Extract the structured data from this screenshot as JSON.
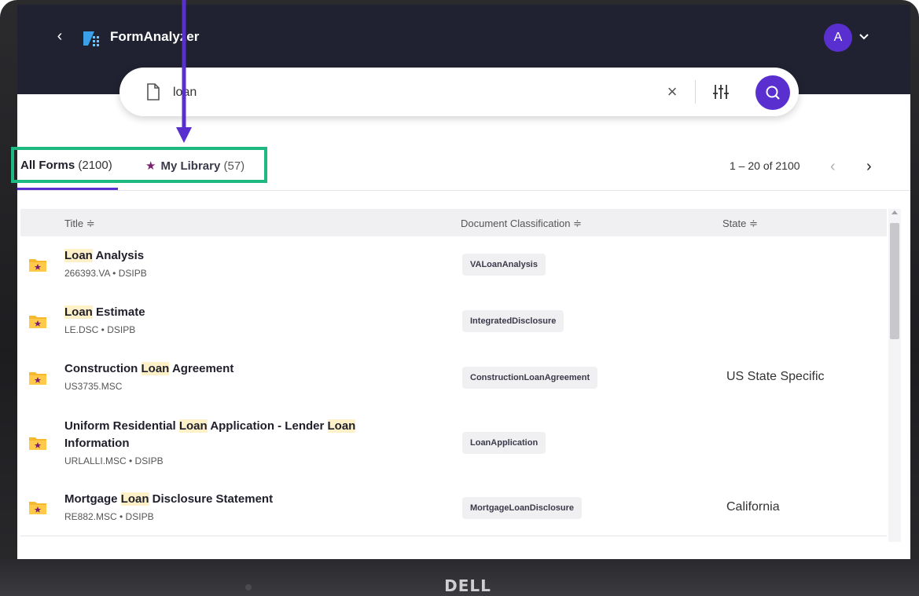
{
  "app": {
    "name": "FormAnalyzer",
    "avatar_initial": "A"
  },
  "search": {
    "value": "loan",
    "placeholder": ""
  },
  "tabs": {
    "all_forms_label": "All Forms",
    "all_forms_count": "(2100)",
    "my_library_label": "My Library",
    "my_library_count": "(57)"
  },
  "pager": {
    "text": "1 – 20 of 2100"
  },
  "columns": {
    "title": "Title ≑",
    "classification": "Document Classification ≑",
    "state": "State ≑"
  },
  "rows": [
    {
      "title_parts": [
        "",
        "Loan",
        " Analysis"
      ],
      "subtitle": "266393.VA • DSIPB",
      "classification": "VALoanAnalysis",
      "state": ""
    },
    {
      "title_parts": [
        "",
        "Loan",
        " Estimate"
      ],
      "subtitle": "LE.DSC • DSIPB",
      "classification": "IntegratedDisclosure",
      "state": ""
    },
    {
      "title_parts": [
        "Construction ",
        "Loan",
        " Agreement"
      ],
      "subtitle": "US3735.MSC",
      "classification": "ConstructionLoanAgreement",
      "state": "US State Specific"
    },
    {
      "title_line1_parts": [
        "Uniform Residential ",
        "Loan",
        " Application - Lender ",
        "Loan"
      ],
      "title_line2": "Information",
      "subtitle": "URLALLI.MSC • DSIPB",
      "classification": "LoanApplication",
      "state": ""
    },
    {
      "title_parts": [
        "Mortgage ",
        "Loan",
        " Disclosure Statement"
      ],
      "subtitle": "RE882.MSC • DSIPB",
      "classification": "MortgageLoanDisclosure",
      "state": "California"
    }
  ],
  "device": {
    "brand": "DELL"
  },
  "colors": {
    "accent": "#5a2fd0",
    "topbar": "#202231",
    "annotation_box": "#1db981",
    "annotation_arrow": "#5a2fd0",
    "highlight": "#fff1c7",
    "library_star": "#7c1d6f"
  }
}
